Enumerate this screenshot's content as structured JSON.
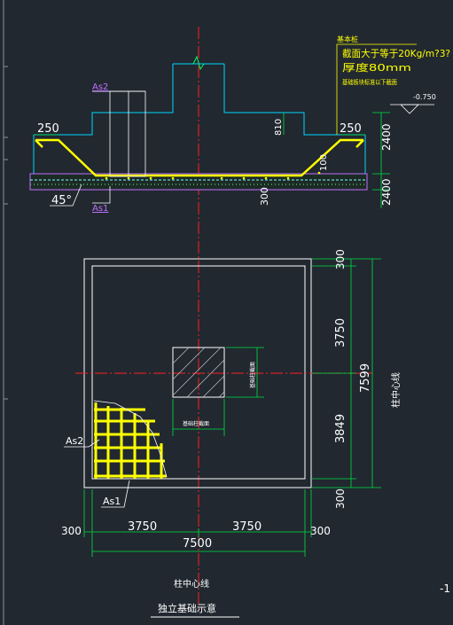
{
  "section": {
    "note_title": "基本桩",
    "note_line1": "截面大于等于20Kg/m?3?",
    "note_line2": "厚度80mm",
    "note_line3": "基础板块标准以下截面",
    "elevation": "-0.750",
    "dim_left_250": "250",
    "dim_right_250": "250",
    "dim_810": "810",
    "dim_2400": "2400",
    "dim_100": "100",
    "dim_2400_b": "2400",
    "dim_300": "300",
    "angle": "45°",
    "label_as2": "As2",
    "label_as1": "As1"
  },
  "plan": {
    "dim_right_top_300": "300",
    "dim_right_3750": "3750",
    "dim_right_total": "7599",
    "dim_right_3849": "3849",
    "dim_right_bottom_300": "300",
    "axis_label_vertical": "柱中心线",
    "col_label_side": "基础柱截面",
    "col_label_bottom": "基础柱截面",
    "label_as2": "As2",
    "label_as1": "As1",
    "dim_bottom_300_left": "300",
    "dim_bottom_3750_left": "3750",
    "dim_bottom_3750_right": "3750",
    "dim_bottom_300_right": "300",
    "dim_bottom_total": "7500"
  },
  "footer": {
    "axis_label": "柱中心线",
    "caption": "独立基础示意",
    "corner_mark": "-1"
  },
  "colors": {
    "background": "#212830",
    "outline": "#ffffff",
    "dimension": "#00e040",
    "column": "#00d8ff",
    "rebar": "#ffff00",
    "axis": "#ff2020",
    "label_purple": "#c070ff"
  }
}
